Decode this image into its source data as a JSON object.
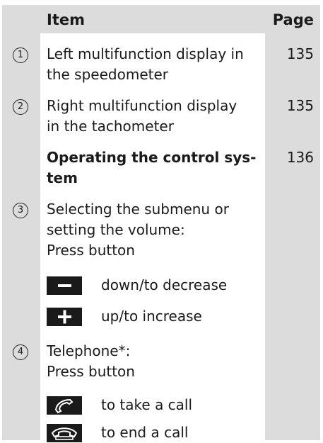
{
  "header": {
    "item": "Item",
    "page": "Page"
  },
  "rows": [
    {
      "num": "1",
      "text_line1": "Left multifunction display in",
      "text_line2": "the speedometer",
      "page": "135"
    },
    {
      "num": "2",
      "text_line1": "Right multifunction display",
      "text_line2": "in the tachometer",
      "page": "135"
    },
    {
      "num": "",
      "text_line1": "Operating the control sys-",
      "text_line2": "tem",
      "page": "136"
    },
    {
      "num": "3",
      "text_line1": "Selecting the submenu or",
      "text_line2": "setting the volume:",
      "text_line3": "Press button"
    },
    {
      "num": "4",
      "text_line1": "Telephone*:",
      "text_line2": "Press button"
    }
  ],
  "buttons": {
    "minus_label": "down/to decrease",
    "plus_label": "up/to increase",
    "take_call_label": "to take a call",
    "end_call_label": "to end a call",
    "minus_icon": "minus-icon",
    "plus_icon": "plus-icon",
    "take_call_icon": "phone-pickup-icon",
    "end_call_icon": "phone-hangup-icon"
  },
  "colors": {
    "shade": "#dcdcdc",
    "text": "#1a1a1a",
    "button": "#1a1a1a"
  }
}
